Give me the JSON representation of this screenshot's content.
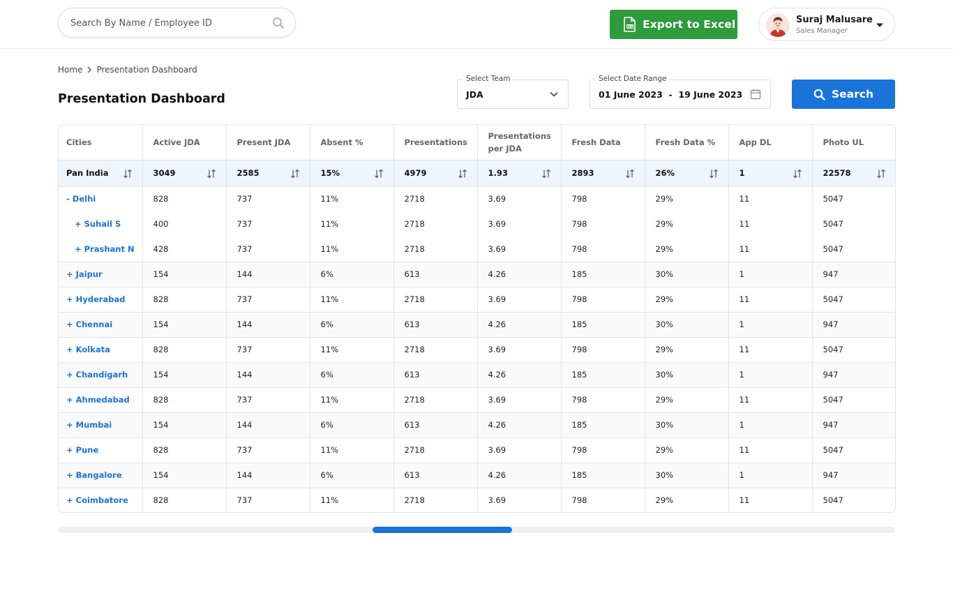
{
  "header": {
    "search": {
      "placeholder": "Search By Name / Employee ID",
      "value": ""
    },
    "export_label": "Export to Excel",
    "export_color": "#2e9b3c",
    "user": {
      "name": "Suraj Malusare",
      "role": "Sales Manager"
    }
  },
  "breadcrumb": {
    "home": "Home",
    "current": "Presentation Dashboard"
  },
  "page_title": "Presentation Dashboard",
  "filters": {
    "team": {
      "label": "Select Team",
      "value": "JDA"
    },
    "date_range": {
      "label": "Select Date Range",
      "value": "01 June 2023  -  19 June 2023"
    },
    "search_label": "Search",
    "search_color": "#1a73d9"
  },
  "table": {
    "columns": [
      "Cities",
      "Active JDA",
      "Present JDA",
      "Absent %",
      "Presentations",
      "Presentations per JDA",
      "Fresh Data",
      "Fresh Data %",
      "App DL",
      "Photo UL"
    ],
    "total": [
      "Pan India",
      "3049",
      "2585",
      "15%",
      "4979",
      "1.93",
      "2893",
      "26%",
      "1",
      "22578"
    ],
    "rows": [
      {
        "cells": [
          "- Delhi",
          "828",
          "737",
          "11%",
          "2718",
          "3.69",
          "798",
          "29%",
          "11",
          "5047"
        ],
        "level": 0
      },
      {
        "cells": [
          "+ Suhail S",
          "400",
          "737",
          "11%",
          "2718",
          "3.69",
          "798",
          "29%",
          "11",
          "5047"
        ],
        "level": 1
      },
      {
        "cells": [
          "+ Prashant N",
          "428",
          "737",
          "11%",
          "2718",
          "3.69",
          "798",
          "29%",
          "11",
          "5047"
        ],
        "level": 1
      },
      {
        "cells": [
          "+ Jaipur",
          "154",
          "144",
          "6%",
          "613",
          "4.26",
          "185",
          "30%",
          "1",
          "947"
        ],
        "level": 0
      },
      {
        "cells": [
          "+ Hyderabad",
          "828",
          "737",
          "11%",
          "2718",
          "3.69",
          "798",
          "29%",
          "11",
          "5047"
        ],
        "level": 0
      },
      {
        "cells": [
          "+ Chennai",
          "154",
          "144",
          "6%",
          "613",
          "4.26",
          "185",
          "30%",
          "1",
          "947"
        ],
        "level": 0
      },
      {
        "cells": [
          "+ Kolkata",
          "828",
          "737",
          "11%",
          "2718",
          "3.69",
          "798",
          "29%",
          "11",
          "5047"
        ],
        "level": 0
      },
      {
        "cells": [
          "+ Chandigarh",
          "154",
          "144",
          "6%",
          "613",
          "4.26",
          "185",
          "30%",
          "1",
          "947"
        ],
        "level": 0
      },
      {
        "cells": [
          "+ Ahmedabad",
          "828",
          "737",
          "11%",
          "2718",
          "3.69",
          "798",
          "29%",
          "11",
          "5047"
        ],
        "level": 0
      },
      {
        "cells": [
          "+ Mumbai",
          "154",
          "144",
          "6%",
          "613",
          "4.26",
          "185",
          "30%",
          "1",
          "947"
        ],
        "level": 0
      },
      {
        "cells": [
          "+ Pune",
          "828",
          "737",
          "11%",
          "2718",
          "3.69",
          "798",
          "29%",
          "11",
          "5047"
        ],
        "level": 0
      },
      {
        "cells": [
          "+ Bangalore",
          "154",
          "144",
          "6%",
          "613",
          "4.26",
          "185",
          "30%",
          "1",
          "947"
        ],
        "level": 0
      },
      {
        "cells": [
          "+ Coimbatore",
          "828",
          "737",
          "11%",
          "2718",
          "3.69",
          "798",
          "29%",
          "11",
          "5047"
        ],
        "level": 0
      }
    ]
  },
  "scrollbar": {
    "position": 0.376,
    "visible_fraction": 0.167
  }
}
